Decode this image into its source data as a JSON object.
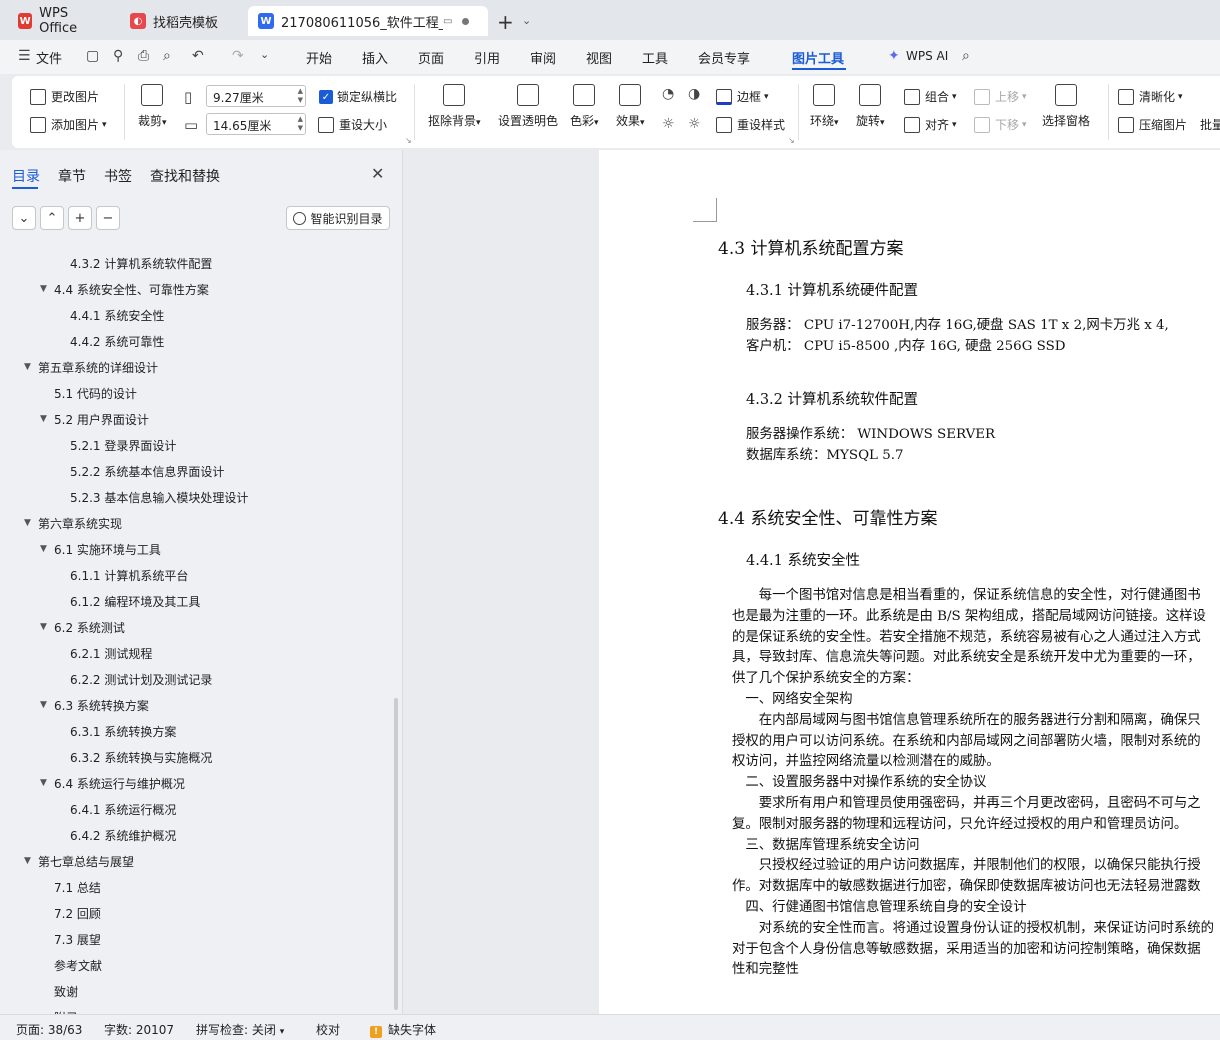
{
  "tabs": [
    {
      "label": "WPS Office",
      "icon": "wps-logo-icon",
      "color": "#e03c31"
    },
    {
      "label": "找稻壳模板",
      "icon": "docer-logo-icon",
      "color": "#e5484d"
    },
    {
      "label": "217080611056_软件工程_肖",
      "icon": "writer-doc-icon",
      "color": "#2f6bf0"
    }
  ],
  "menu": {
    "file": "文件",
    "items": [
      "开始",
      "插入",
      "页面",
      "引用",
      "审阅",
      "视图",
      "工具",
      "会员专享",
      "图片工具"
    ],
    "active": "图片工具",
    "wps_ai": "WPS AI"
  },
  "ribbon": {
    "change_pic": "更改图片",
    "add_pic": "添加图片",
    "crop": "裁剪",
    "width_value": "9.27厘米",
    "height_value": "14.65厘米",
    "lock_ratio": "锁定纵横比",
    "resize": "重设大小",
    "remove_bg": "抠除背景",
    "transparent": "设置透明色",
    "color": "色彩",
    "effect": "效果",
    "border": "边框",
    "reset_style": "重设样式",
    "wrap": "环绕",
    "rotate": "旋转",
    "group": "组合",
    "align": "对齐",
    "move_up": "上移",
    "move_down": "下移",
    "select_pane": "选择窗格",
    "sharpen": "清晰化",
    "compress": "压缩图片",
    "batch": "批量"
  },
  "nav": {
    "tabs": [
      "目录",
      "章节",
      "书签",
      "查找和替换"
    ],
    "smart_toc": "智能识别目录",
    "toc": [
      {
        "label": "4.3.2 计算机系统软件配置",
        "level": 3,
        "arrow": false
      },
      {
        "label": "4.4 系统安全性、可靠性方案",
        "level": 2,
        "arrow": true
      },
      {
        "label": "4.4.1 系统安全性",
        "level": 3,
        "arrow": false
      },
      {
        "label": "4.4.2 系统可靠性",
        "level": 3,
        "arrow": false
      },
      {
        "label": "第五章系统的详细设计",
        "level": 1,
        "arrow": true
      },
      {
        "label": "5.1 代码的设计",
        "level": 2,
        "arrow": false
      },
      {
        "label": "5.2 用户界面设计",
        "level": 2,
        "arrow": true
      },
      {
        "label": "5.2.1 登录界面设计",
        "level": 3,
        "arrow": false
      },
      {
        "label": "5.2.2 系统基本信息界面设计",
        "level": 3,
        "arrow": false
      },
      {
        "label": "5.2.3 基本信息输入模块处理设计",
        "level": 3,
        "arrow": false
      },
      {
        "label": "第六章系统实现",
        "level": 1,
        "arrow": true
      },
      {
        "label": "6.1 实施环境与工具",
        "level": 2,
        "arrow": true
      },
      {
        "label": "6.1.1 计算机系统平台",
        "level": 3,
        "arrow": false
      },
      {
        "label": "6.1.2 编程环境及其工具",
        "level": 3,
        "arrow": false
      },
      {
        "label": "6.2 系统测试",
        "level": 2,
        "arrow": true
      },
      {
        "label": "6.2.1 测试规程",
        "level": 3,
        "arrow": false
      },
      {
        "label": "6.2.2 测试计划及测试记录",
        "level": 3,
        "arrow": false
      },
      {
        "label": "6.3 系统转换方案",
        "level": 2,
        "arrow": true
      },
      {
        "label": "6.3.1 系统转换方案",
        "level": 3,
        "arrow": false
      },
      {
        "label": "6.3.2 系统转换与实施概况",
        "level": 3,
        "arrow": false
      },
      {
        "label": "6.4 系统运行与维护概况",
        "level": 2,
        "arrow": true
      },
      {
        "label": "6.4.1 系统运行概况",
        "level": 3,
        "arrow": false
      },
      {
        "label": "6.4.2 系统维护概况",
        "level": 3,
        "arrow": false
      },
      {
        "label": "第七章总结与展望",
        "level": 1,
        "arrow": true
      },
      {
        "label": "7.1 总结",
        "level": 2,
        "arrow": false
      },
      {
        "label": "7.2 回顾",
        "level": 2,
        "arrow": false
      },
      {
        "label": "7.3 展望",
        "level": 2,
        "arrow": false
      },
      {
        "label": "参考文献",
        "level": 2,
        "arrow": false
      },
      {
        "label": "致谢",
        "level": 2,
        "arrow": false
      },
      {
        "label": "附录",
        "level": 2,
        "arrow": false
      }
    ]
  },
  "doc": {
    "h_43": "4.3 计算机系统配置方案",
    "h_431": "4.3.1 计算机系统硬件配置",
    "hw_server": "服务器：  CPU i7-12700H,内存 16G,硬盘 SAS 1T x 2,网卡万兆  x 4,",
    "hw_client": "客户机：  CPU i5-8500 ,内存 16G, 硬盘 256G SSD",
    "h_432": "4.3.2 计算机系统软件配置",
    "sw_os": "服务器操作系统：   WINDOWS SERVER",
    "sw_db": "数据库系统：MYSQL 5.7",
    "h_44": "4.4 系统安全性、可靠性方案",
    "h_441": "4.4.1 系统安全性",
    "lines": [
      "　　每一个图书馆对信息是相当看重的，保证系统信息的安全性，对行健通图书",
      "也是最为注重的一环。此系统是由 B/S 架构组成，搭配局域网访问链接。这样设",
      "的是保证系统的安全性。若安全措施不规范，系统容易被有心之人通过注入方式",
      "具，导致封库、信息流失等问题。对此系统安全是系统开发中尤为重要的一环，",
      "供了几个保护系统安全的方案：",
      "　一、网络安全架构",
      "　　在内部局域网与图书馆信息管理系统所在的服务器进行分割和隔离，确保只",
      "授权的用户可以访问系统。在系统和内部局域网之间部署防火墙，限制对系统的",
      "权访问，并监控网络流量以检测潜在的威胁。",
      "　二、设置服务器中对操作系统的安全协议",
      "　　要求所有用户和管理员使用强密码，并再三个月更改密码，且密码不可与之",
      "复。限制对服务器的物理和远程访问，只允许经过授权的用户和管理员访问。",
      "　三、数据库管理系统安全访问",
      "　　只授权经过验证的用户访问数据库，并限制他们的权限，以确保只能执行授",
      "作。对数据库中的敏感数据进行加密，确保即使数据库被访问也无法轻易泄露数",
      "　四、行健通图书馆信息管理系统自身的安全设计",
      "　　对系统的安全性而言。将通过设置身份认证的授权机制，来保证访问时系统的",
      "对于包含个人身份信息等敏感数据，采用适当的加密和访问控制策略，确保数据",
      "性和完整性"
    ]
  },
  "status": {
    "page": "页面: 38/63",
    "words": "字数: 20107",
    "spell": "拼写检查: 关闭",
    "proof": "校对",
    "missing_font": "缺失字体"
  }
}
